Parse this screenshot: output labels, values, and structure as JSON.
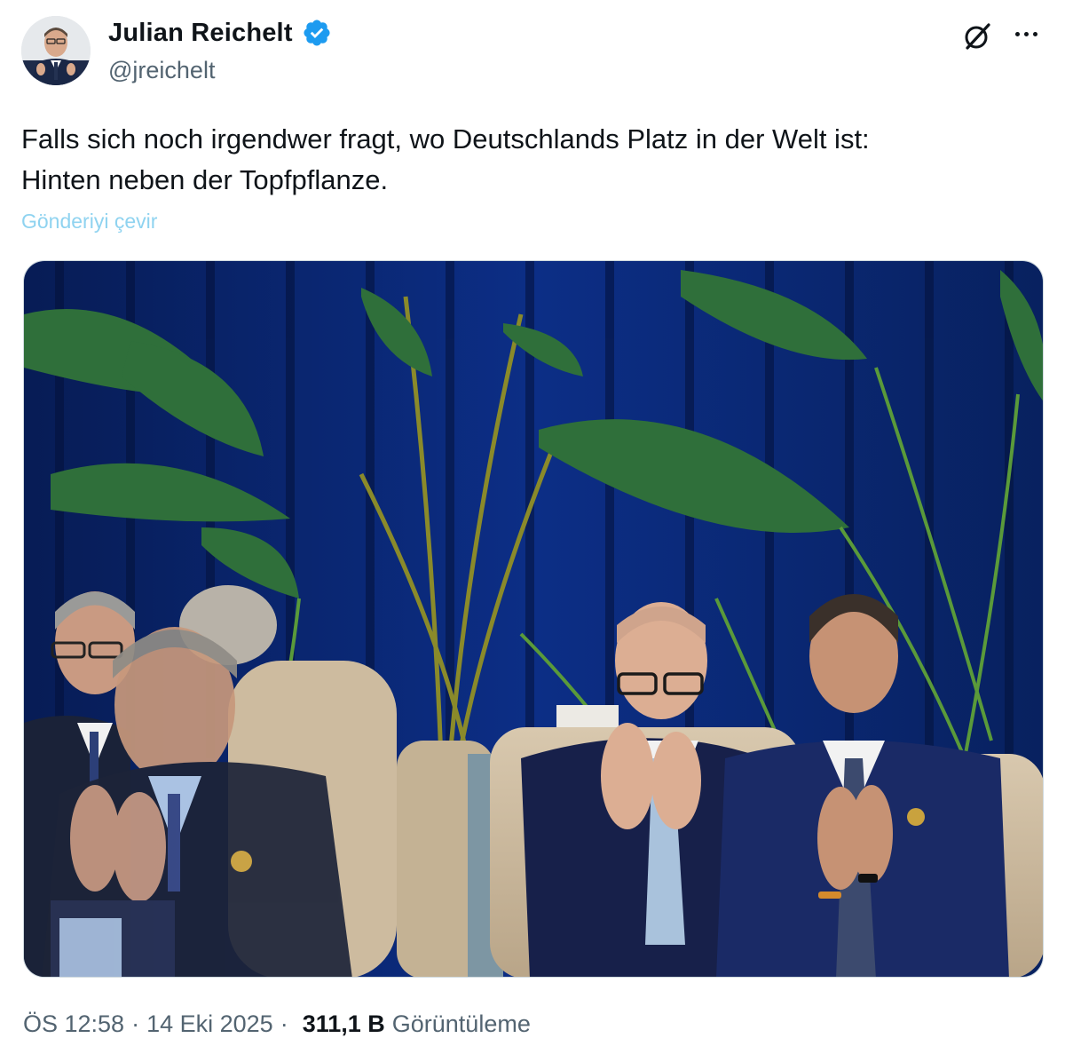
{
  "author": {
    "name": "Julian Reichelt",
    "handle": "@jreichelt",
    "verified": true,
    "badge_color": "#1d9bf0"
  },
  "icons": {
    "grok": "grok-icon",
    "more": "more-icon",
    "verified": "verified-badge-icon"
  },
  "tweet": {
    "text_line1": "Falls sich noch irgendwer fragt, wo Deutschlands Platz in der Welt ist:",
    "text_line2": "Hinten neben der Topfpflanze.",
    "translate_label": "Gönderiyi çevir"
  },
  "media": {
    "kind": "photo",
    "curtain_color": "#0a2a7a"
  },
  "meta": {
    "time": "ÖS 12:58",
    "date": "14 Eki 2025",
    "separator": "·",
    "views_count": "311,1 B",
    "views_label": "Görüntüleme"
  }
}
